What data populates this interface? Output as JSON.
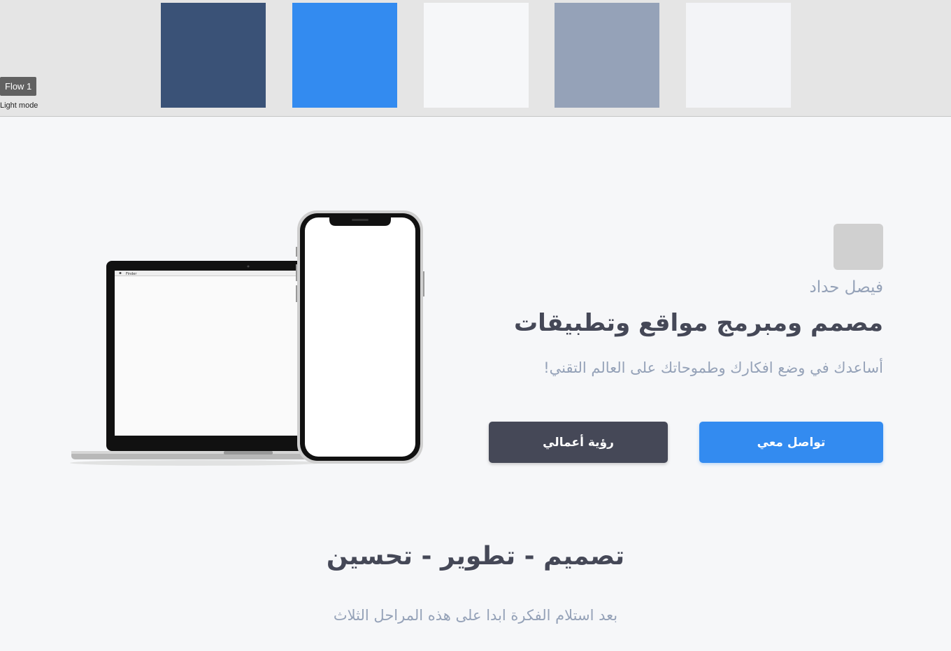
{
  "canvas": {
    "flow_label": "Flow 1",
    "mode_label": "Light mode",
    "swatches": [
      {
        "name": "navy",
        "color": "#3a5277"
      },
      {
        "name": "blue",
        "color": "#338bf0"
      },
      {
        "name": "off-white",
        "color": "#f6f7f9"
      },
      {
        "name": "slate",
        "color": "#95a2b8"
      },
      {
        "name": "light-gray",
        "color": "#f3f4f7"
      }
    ]
  },
  "hero": {
    "name": "فيصل حداد",
    "title": "مصمم ومبرمج مواقع وتطبيقات",
    "subtitle": "أساعدك في وضع افكارك وطموحاتك على العالم التقني!",
    "primary_button": "تواصل معي",
    "secondary_button": "رؤية أعمالي",
    "mockup_app_label": "Finder"
  },
  "section": {
    "title": "تصميم - تطوير - تحسين",
    "subtitle": "بعد استلام الفكرة ابدا على هذه المراحل الثلاث"
  },
  "colors": {
    "background": "#f6f7f9",
    "accent": "#338bf0",
    "dark": "#454857",
    "muted": "#95a2b8"
  }
}
